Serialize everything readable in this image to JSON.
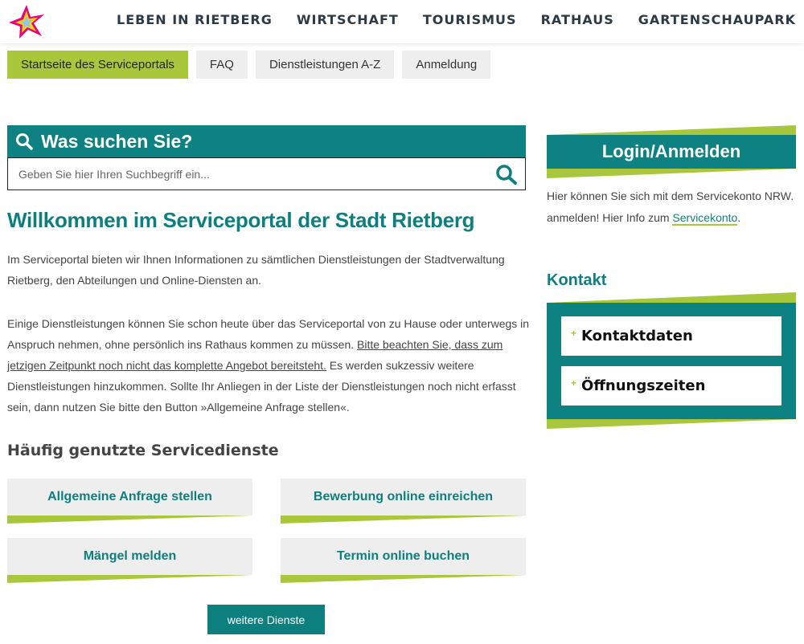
{
  "header": {
    "nav": [
      "LEBEN IN RIETBERG",
      "WIRTSCHAFT",
      "TOURISMUS",
      "RATHAUS",
      "GARTENSCHAUPARK"
    ]
  },
  "tabs": [
    {
      "label": "Startseite des Serviceportals",
      "active": true
    },
    {
      "label": "FAQ",
      "active": false
    },
    {
      "label": "Dienstleistungen A-Z",
      "active": false
    },
    {
      "label": "Anmeldung",
      "active": false
    }
  ],
  "search": {
    "title": "Was suchen Sie?",
    "placeholder": "Geben Sie hier Ihren Suchbegriff ein..."
  },
  "welcome": {
    "title": "Willkommen im Serviceportal der Stadt Rietberg",
    "para1": "Im Serviceportal bieten wir Ihnen Informationen zu sämtlichen Dienstleistungen der Stadtverwaltung Riet­berg, den Abteilungen und Online-Diensten an.",
    "para2_a": "Einige Dienstleistungen können Sie schon heute über das Serviceportal von zu Hause oder unterwegs in An­spruch nehmen, ohne persönlich ins Rathaus kommen zu müssen. ",
    "para2_link": "Bitte beachten Sie, dass zum jetzigen Zeit­punkt noch nicht das komplette Angebot bereitsteht.",
    "para2_b": " Es werden sukzessiv weitere Dienstleistungen hinzu­kommen. Sollte Ihr Anliegen in der Liste der Dienstleistungen noch nicht erfasst sein, dann nutzen Sie bitte den Button »Allgemeine Anfrage stellen«."
  },
  "services": {
    "title": "Häufig genutzte Servicedienste",
    "items": [
      "Allgemeine Anfrage stellen",
      "Bewerbung online einreichen",
      "Mängel melden",
      "Termin online buchen"
    ],
    "more_label": "weitere Dienste"
  },
  "sidebar": {
    "login_label": "Login/Anmelden",
    "login_text": "Hier können Sie sich mit dem Servicekonto NRW. anmelden! Hier Info zum ",
    "login_link": "Servicekonto",
    "login_text_end": ".",
    "kontakt_title": "Kontakt",
    "kontakt_items": [
      "Kontaktdaten",
      "Öffnungszeiten"
    ]
  },
  "colors": {
    "teal": "#0e8282",
    "green": "#a8c73a"
  }
}
